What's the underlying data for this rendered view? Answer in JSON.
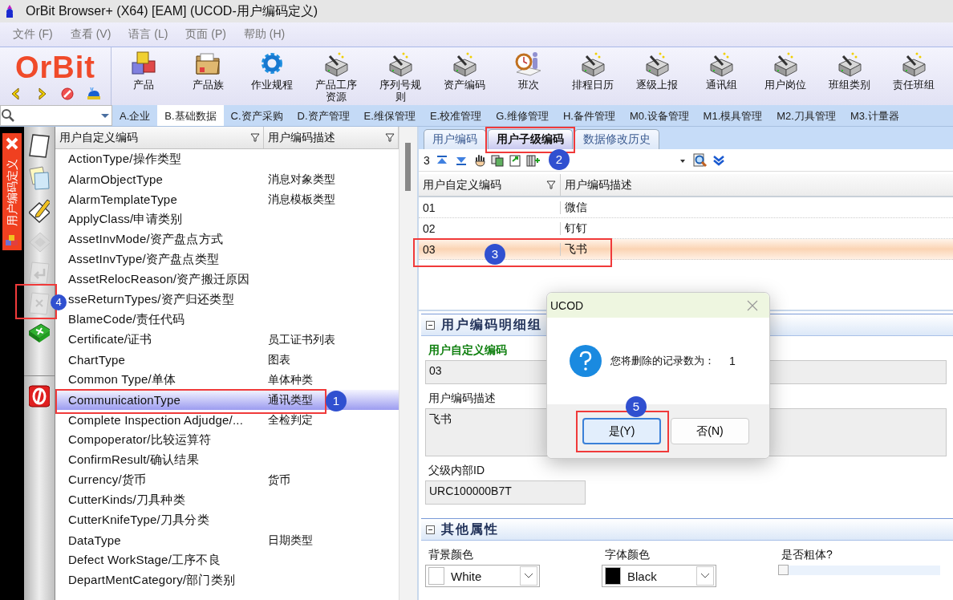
{
  "window": {
    "title": "OrBit Browser+ (X64) [EAM] (UCOD-用户编码定义)"
  },
  "menu": [
    "文件 (F)",
    "查看 (V)",
    "语言 (L)",
    "页面 (P)",
    "帮助 (H)"
  ],
  "logo": "OrBit",
  "toolbar": [
    {
      "label": "产品",
      "kind": "cubes"
    },
    {
      "label": "产品族",
      "kind": "folder"
    },
    {
      "label": "作业规程",
      "kind": "gear"
    },
    {
      "label": "产品工序资源",
      "kind": "wand"
    },
    {
      "label": "序列号规则",
      "kind": "wand"
    },
    {
      "label": "资产编码",
      "kind": "wand"
    },
    {
      "label": "班次",
      "kind": "clock"
    },
    {
      "label": "排程日历",
      "kind": "wand"
    },
    {
      "label": "逐级上报",
      "kind": "wand"
    },
    {
      "label": "通讯组",
      "kind": "wand"
    },
    {
      "label": "用户岗位",
      "kind": "wand"
    },
    {
      "label": "班组类别",
      "kind": "wand"
    },
    {
      "label": "责任班组",
      "kind": "wand"
    }
  ],
  "module_tabs": [
    {
      "label": "A.企业",
      "selected": false
    },
    {
      "label": "B.基础数据",
      "selected": true
    },
    {
      "label": "C.资产采购",
      "selected": false
    },
    {
      "label": "D.资产管理",
      "selected": false
    },
    {
      "label": "E.维保管理",
      "selected": false
    },
    {
      "label": "E.校准管理",
      "selected": false
    },
    {
      "label": "G.维修管理",
      "selected": false
    },
    {
      "label": "H.备件管理",
      "selected": false
    },
    {
      "label": "M0.设备管理",
      "selected": false
    },
    {
      "label": "M1.模具管理",
      "selected": false
    },
    {
      "label": "M2.刀具管理",
      "selected": false
    },
    {
      "label": "M3.计量器",
      "selected": false
    }
  ],
  "side_tab": {
    "title": "用户编码定义"
  },
  "side_tools": [
    {
      "kind": "new",
      "disabled": false
    },
    {
      "kind": "copy",
      "disabled": false
    },
    {
      "kind": "edit",
      "disabled": false
    },
    {
      "kind": "save",
      "disabled": true
    },
    {
      "kind": "undo",
      "disabled": true
    },
    {
      "kind": "delete",
      "disabled": true,
      "marker": "4"
    },
    {
      "kind": "excel",
      "disabled": false
    },
    {
      "kind": "exit",
      "disabled": false
    }
  ],
  "code_list": {
    "columns": [
      "用户自定义编码",
      "用户编码描述"
    ],
    "rows": [
      {
        "code": "ActionType/操作类型",
        "description": "",
        "selected": false
      },
      {
        "code": "AlarmObjectType",
        "description": "消息对象类型",
        "selected": false
      },
      {
        "code": "AlarmTemplateType",
        "description": "消息模板类型",
        "selected": false
      },
      {
        "code": "ApplyClass/申请类别",
        "description": "",
        "selected": false
      },
      {
        "code": "AssetInvMode/资产盘点方式",
        "description": "",
        "selected": false
      },
      {
        "code": "AssetInvType/资产盘点类型",
        "description": "",
        "selected": false
      },
      {
        "code": "AssetRelocReason/资产搬迁原因",
        "description": "",
        "selected": false
      },
      {
        "code": "sseReturnTypes/资产归还类型",
        "description": "",
        "selected": false
      },
      {
        "code": "BlameCode/责任代码",
        "description": "",
        "selected": false
      },
      {
        "code": "Certificate/证书",
        "description": "员工证书列表",
        "selected": false
      },
      {
        "code": "ChartType",
        "description": "图表",
        "selected": false
      },
      {
        "code": "Common Type/单体",
        "description": "单体种类",
        "selected": false
      },
      {
        "code": "CommunicationType",
        "description": "通讯类型",
        "selected": true,
        "marker": "1"
      },
      {
        "code": "Complete Inspection Adjudge/...",
        "description": "全检判定",
        "selected": false
      },
      {
        "code": "Compoperator/比较运算符",
        "description": "",
        "selected": false
      },
      {
        "code": "ConfirmResult/确认结果",
        "description": "",
        "selected": false
      },
      {
        "code": "Currency/货币",
        "description": "货币",
        "selected": false
      },
      {
        "code": "CutterKinds/刀具种类",
        "description": "",
        "selected": false
      },
      {
        "code": "CutterKnifeType/刀具分类",
        "description": "",
        "selected": false
      },
      {
        "code": "DataType",
        "description": "日期类型",
        "selected": false
      },
      {
        "code": "Defect WorkStage/工序不良",
        "description": "",
        "selected": false
      },
      {
        "code": "DepartMentCategory/部门类别",
        "description": "",
        "selected": false
      }
    ]
  },
  "detail_tabs": [
    {
      "label": "用户编码",
      "selected": false
    },
    {
      "label": "用户子级编码",
      "selected": true,
      "marker": "2"
    },
    {
      "label": "数据修改历史",
      "selected": false
    }
  ],
  "child_grid": {
    "record_count": "3",
    "columns": [
      "用户自定义编码",
      "用户编码描述"
    ],
    "rows": [
      {
        "code": "01",
        "description": "微信",
        "selected": false
      },
      {
        "code": "02",
        "description": "钉钉",
        "selected": false
      },
      {
        "code": "03",
        "description": "飞书",
        "selected": true,
        "marker": "3"
      }
    ]
  },
  "detail_group": {
    "title": "用户编码明细组",
    "fields": [
      {
        "label": "用户自定义编码",
        "value": "03",
        "required": true,
        "kind": "wide"
      },
      {
        "label": "用户编码描述",
        "value": "飞书",
        "required": false,
        "kind": "multiline"
      },
      {
        "label": "父级内部ID",
        "value": "URC100000B7T",
        "required": false,
        "kind": "short"
      }
    ]
  },
  "other_group": {
    "title": "其他属性",
    "colors": [
      {
        "label": "背景颜色",
        "value": "White",
        "color": "#ffffff"
      },
      {
        "label": "字体颜色",
        "value": "Black",
        "color": "#000000"
      }
    ],
    "bold": {
      "label": "是否粗体?",
      "checked": false
    }
  },
  "dialog": {
    "title": "UCOD",
    "message": "您将删除的记录数为：",
    "count": "1",
    "buttons": [
      {
        "label": "是(Y)",
        "selected": true,
        "marker": "5"
      },
      {
        "label": "否(N)",
        "selected": false
      }
    ]
  }
}
